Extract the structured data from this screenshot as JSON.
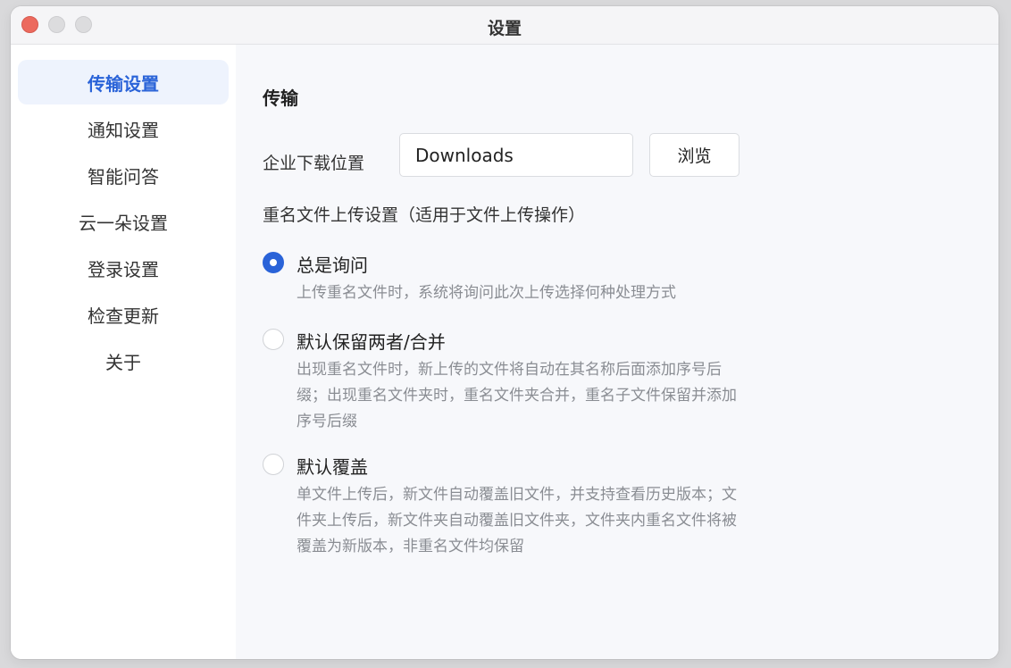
{
  "window": {
    "title": "设置"
  },
  "sidebar": {
    "items": [
      {
        "label": "传输设置",
        "active": true
      },
      {
        "label": "通知设置"
      },
      {
        "label": "智能问答"
      },
      {
        "label": "云一朵设置"
      },
      {
        "label": "登录设置"
      },
      {
        "label": "检查更新"
      },
      {
        "label": "关于"
      }
    ]
  },
  "main": {
    "section_title": "传输",
    "download": {
      "label": "企业下载位置",
      "value": "Downloads",
      "browse_label": "浏览"
    },
    "rename": {
      "group_label": "重名文件上传设置（适用于文件上传操作）",
      "options": [
        {
          "label": "总是询问",
          "desc": "上传重名文件时，系统将询问此次上传选择何种处理方式",
          "checked": true
        },
        {
          "label": "默认保留两者/合并",
          "desc": "出现重名文件时，新上传的文件将自动在其名称后面添加序号后缀；出现重名文件夹时，重名文件夹合并，重名子文件保留并添加序号后缀"
        },
        {
          "label": "默认覆盖",
          "desc": "单文件上传后，新文件自动覆盖旧文件，并支持查看历史版本；文件夹上传后，新文件夹自动覆盖旧文件夹，文件夹内重名文件将被覆盖为新版本，非重名文件均保留"
        }
      ]
    }
  },
  "colors": {
    "accent": "#2a63d8",
    "sidebar_active_bg": "#eef3fd",
    "close": "#ec6a5e"
  }
}
